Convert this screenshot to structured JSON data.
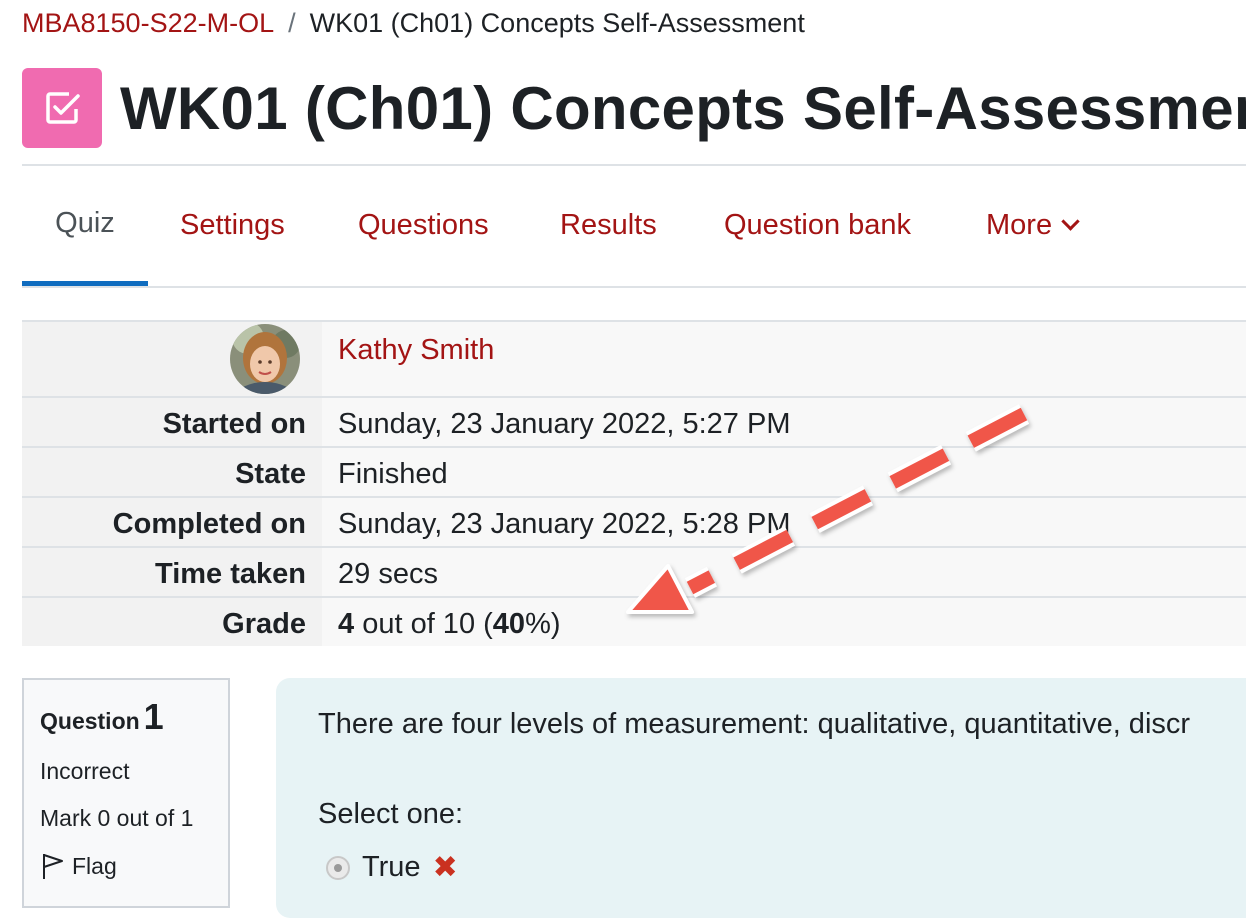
{
  "breadcrumb": {
    "course": "MBA8150-S22-M-OL",
    "separator": "/",
    "current": "WK01 (Ch01) Concepts Self-Assessment"
  },
  "header": {
    "title": "WK01 (Ch01) Concepts Self-Assessmen",
    "icon": "quiz-checkbox-icon",
    "icon_color": "#f06bb0"
  },
  "tabs": {
    "quiz": "Quiz",
    "settings": "Settings",
    "questions": "Questions",
    "results": "Results",
    "question_bank": "Question bank",
    "more": "More"
  },
  "summary": {
    "user_name": "Kathy Smith",
    "started_label": "Started on",
    "started_value": "Sunday, 23 January 2022, 5:27 PM",
    "state_label": "State",
    "state_value": "Finished",
    "completed_label": "Completed on",
    "completed_value": "Sunday, 23 January 2022, 5:28 PM",
    "time_label": "Time taken",
    "time_value": "29 secs",
    "grade_label": "Grade",
    "grade_score": "4",
    "grade_middle": " out of 10 (",
    "grade_percent": "40",
    "grade_end": "%)"
  },
  "question": {
    "label": "Question",
    "number": "1",
    "status": "Incorrect",
    "mark": "Mark 0 out of 1",
    "flag": "Flag",
    "text": "There are four levels of measurement: qualitative, quantitative, discr",
    "prompt": "Select one:",
    "answer": "True",
    "answer_mark": "✖"
  },
  "colors": {
    "link": "#a31414",
    "active_tab_underline": "#0f6cbf",
    "annotation_arrow": "#f0564a",
    "question_bg": "#e7f3f5"
  }
}
